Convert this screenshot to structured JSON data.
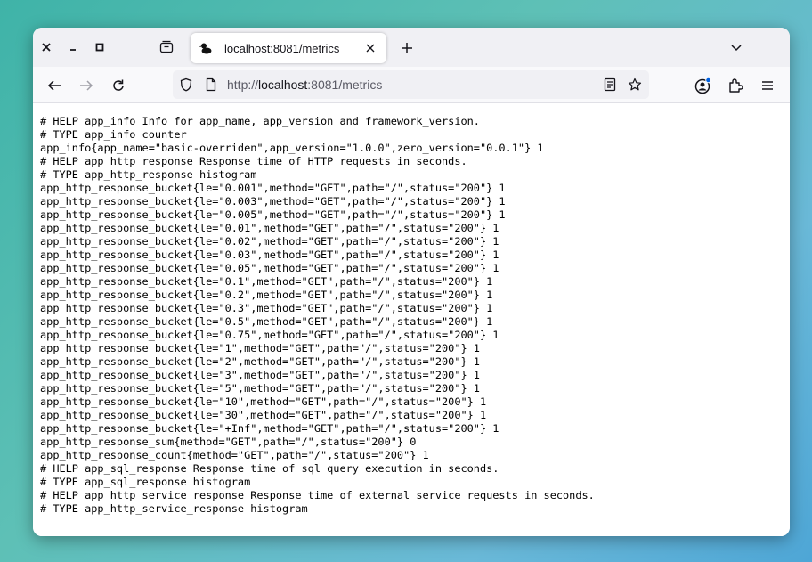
{
  "window_controls": {
    "close_icon": "close-icon",
    "minimize_icon": "minimize-icon",
    "maximize_icon": "maximize-icon"
  },
  "tab": {
    "title": "localhost:8081/metrics",
    "favicon": "duck-icon"
  },
  "navbar": {
    "url_prefix": "http://",
    "url_host": "localhost",
    "url_rest": ":8081/metrics"
  },
  "metrics_lines": [
    "# HELP app_info Info for app_name, app_version and framework_version.",
    "# TYPE app_info counter",
    "app_info{app_name=\"basic-overriden\",app_version=\"1.0.0\",zero_version=\"0.0.1\"} 1",
    "# HELP app_http_response Response time of HTTP requests in seconds.",
    "# TYPE app_http_response histogram",
    "app_http_response_bucket{le=\"0.001\",method=\"GET\",path=\"/\",status=\"200\"} 1",
    "app_http_response_bucket{le=\"0.003\",method=\"GET\",path=\"/\",status=\"200\"} 1",
    "app_http_response_bucket{le=\"0.005\",method=\"GET\",path=\"/\",status=\"200\"} 1",
    "app_http_response_bucket{le=\"0.01\",method=\"GET\",path=\"/\",status=\"200\"} 1",
    "app_http_response_bucket{le=\"0.02\",method=\"GET\",path=\"/\",status=\"200\"} 1",
    "app_http_response_bucket{le=\"0.03\",method=\"GET\",path=\"/\",status=\"200\"} 1",
    "app_http_response_bucket{le=\"0.05\",method=\"GET\",path=\"/\",status=\"200\"} 1",
    "app_http_response_bucket{le=\"0.1\",method=\"GET\",path=\"/\",status=\"200\"} 1",
    "app_http_response_bucket{le=\"0.2\",method=\"GET\",path=\"/\",status=\"200\"} 1",
    "app_http_response_bucket{le=\"0.3\",method=\"GET\",path=\"/\",status=\"200\"} 1",
    "app_http_response_bucket{le=\"0.5\",method=\"GET\",path=\"/\",status=\"200\"} 1",
    "app_http_response_bucket{le=\"0.75\",method=\"GET\",path=\"/\",status=\"200\"} 1",
    "app_http_response_bucket{le=\"1\",method=\"GET\",path=\"/\",status=\"200\"} 1",
    "app_http_response_bucket{le=\"2\",method=\"GET\",path=\"/\",status=\"200\"} 1",
    "app_http_response_bucket{le=\"3\",method=\"GET\",path=\"/\",status=\"200\"} 1",
    "app_http_response_bucket{le=\"5\",method=\"GET\",path=\"/\",status=\"200\"} 1",
    "app_http_response_bucket{le=\"10\",method=\"GET\",path=\"/\",status=\"200\"} 1",
    "app_http_response_bucket{le=\"30\",method=\"GET\",path=\"/\",status=\"200\"} 1",
    "app_http_response_bucket{le=\"+Inf\",method=\"GET\",path=\"/\",status=\"200\"} 1",
    "app_http_response_sum{method=\"GET\",path=\"/\",status=\"200\"} 0",
    "app_http_response_count{method=\"GET\",path=\"/\",status=\"200\"} 1",
    "# HELP app_sql_response Response time of sql query execution in seconds.",
    "# TYPE app_sql_response histogram",
    "# HELP app_http_service_response Response time of external service requests in seconds.",
    "# TYPE app_http_service_response histogram"
  ],
  "colors": {
    "accent": "#0061e0",
    "toolbar": "#f9f9fb",
    "tabstrip": "#f0f0f4"
  }
}
